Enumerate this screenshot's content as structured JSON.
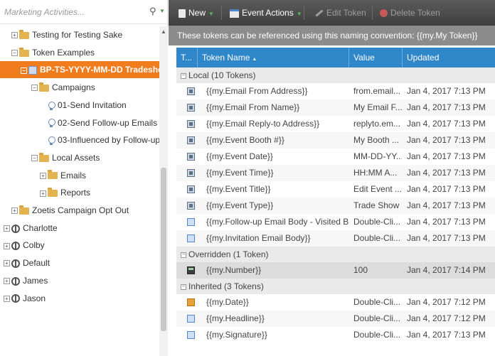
{
  "left_panel": {
    "search_placeholder": "Marketing Activities...",
    "tree": [
      {
        "label": "Testing for Testing Sake",
        "expander": "+",
        "icon": "folder"
      },
      {
        "label": "Token Examples",
        "expander": "−",
        "icon": "folder"
      },
      {
        "label": "BP-TS-YYYY-MM-DD Tradeshow",
        "expander": "−",
        "icon": "program",
        "selected": true
      },
      {
        "label": "Campaigns",
        "expander": "−",
        "icon": "folder"
      },
      {
        "label": "01-Send Invitation",
        "icon": "campaign-bulb"
      },
      {
        "label": "02-Send Follow-up Emails",
        "icon": "campaign-bulb"
      },
      {
        "label": "03-Influenced by Follow-up",
        "icon": "campaign-bulb"
      },
      {
        "label": "Local Assets",
        "expander": "−",
        "icon": "folder"
      },
      {
        "label": "Emails",
        "expander": "+",
        "icon": "folder"
      },
      {
        "label": "Reports",
        "expander": "+",
        "icon": "folder"
      },
      {
        "label": "Zoetis Campaign Opt Out",
        "expander": "+",
        "icon": "folder"
      },
      {
        "label": "Charlotte",
        "expander": "+",
        "icon": "globe"
      },
      {
        "label": "Colby",
        "expander": "+",
        "icon": "globe"
      },
      {
        "label": "Default",
        "expander": "+",
        "icon": "globe"
      },
      {
        "label": "James",
        "expander": "+",
        "icon": "globe"
      },
      {
        "label": "Jason",
        "expander": "+",
        "icon": "globe"
      }
    ]
  },
  "toolbar": {
    "new_label": "New",
    "event_actions_label": "Event Actions",
    "edit_token_label": "Edit Token",
    "delete_token_label": "Delete Token"
  },
  "info_text": "These tokens can be referenced using this naming convention: {{my.My Token}}",
  "table": {
    "headers": {
      "type": "T...",
      "name": "Token Name",
      "value": "Value",
      "updated": "Updated"
    },
    "groups": [
      {
        "title": "Local (10 Tokens)",
        "rows": [
          {
            "icon": "image",
            "name": "{{my.Email From Address}}",
            "value": "from.email...",
            "updated": "Jan 4, 2017 7:13 PM"
          },
          {
            "icon": "image",
            "name": "{{my.Email From Name}}",
            "value": "My Email F...",
            "updated": "Jan 4, 2017 7:13 PM"
          },
          {
            "icon": "image",
            "name": "{{my.Email Reply-to Address}}",
            "value": "replyto.em...",
            "updated": "Jan 4, 2017 7:13 PM"
          },
          {
            "icon": "image",
            "name": "{{my.Event Booth #}}",
            "value": "My Booth ...",
            "updated": "Jan 4, 2017 7:13 PM"
          },
          {
            "icon": "image",
            "name": "{{my.Event Date}}",
            "value": "MM-DD-YY...",
            "updated": "Jan 4, 2017 7:13 PM"
          },
          {
            "icon": "image",
            "name": "{{my.Event Time}}",
            "value": "HH:MM A...",
            "updated": "Jan 4, 2017 7:13 PM"
          },
          {
            "icon": "image",
            "name": "{{my.Event Title}}",
            "value": "Edit Event ...",
            "updated": "Jan 4, 2017 7:13 PM"
          },
          {
            "icon": "image",
            "name": "{{my.Event Type}}",
            "value": "Trade Show",
            "updated": "Jan 4, 2017 7:13 PM"
          },
          {
            "icon": "html",
            "name": "{{my.Follow-up Email Body - Visited B...",
            "value": "Double-Cli...",
            "updated": "Jan 4, 2017 7:13 PM"
          },
          {
            "icon": "html",
            "name": "{{my.Invitation Email Body}}",
            "value": "Double-Cli...",
            "updated": "Jan 4, 2017 7:13 PM"
          }
        ]
      },
      {
        "title": "Overridden (1 Token)",
        "rows": [
          {
            "icon": "number",
            "name": "{{my.Number}}",
            "value": "100",
            "updated": "Jan 4, 2017 7:14 PM"
          }
        ]
      },
      {
        "title": "Inherited (3 Tokens)",
        "rows": [
          {
            "icon": "date",
            "name": "{{my.Date}}",
            "value": "Double-Cli...",
            "updated": "Jan 4, 2017 7:12 PM"
          },
          {
            "icon": "html",
            "name": "{{my.Headline}}",
            "value": "Double-Cli...",
            "updated": "Jan 4, 2017 7:12 PM"
          },
          {
            "icon": "html",
            "name": "{{my.Signature}}",
            "value": "Double-Cli...",
            "updated": "Jan 4, 2017 7:13 PM"
          }
        ]
      }
    ]
  },
  "colors": {
    "selected_node": "#f07c1e",
    "header_blue": "#2f86c9",
    "toolbar_dark": "#4a4a4a",
    "info_bar": "#8c8c8c",
    "dropdown_green": "#58b95a"
  }
}
